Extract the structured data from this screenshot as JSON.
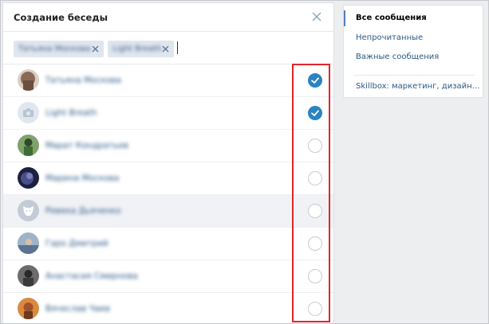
{
  "modal": {
    "title": "Создание беседы",
    "close_icon": "close-icon",
    "chips": [
      {
        "name": "Татьяна Москова"
      },
      {
        "name": "Light Breath"
      }
    ],
    "rows": [
      {
        "name": "Татьяна Москова",
        "checked": true,
        "avatar_color": "#8a6a55"
      },
      {
        "name": "Light Breath",
        "checked": true,
        "avatar_color": "#e1e7ee"
      },
      {
        "name": "Марат Кондратьев",
        "checked": false,
        "avatar_color": "#3f6a3a"
      },
      {
        "name": "Марина Москова",
        "checked": false,
        "avatar_color": "#2d3460"
      },
      {
        "name": "Ревека Дьяченко",
        "checked": false,
        "avatar_color": "#c3ccd6"
      },
      {
        "name": "Гаро Дмитрий",
        "checked": false,
        "avatar_color": "#5b7290"
      },
      {
        "name": "Анастасия Смирнова",
        "checked": false,
        "avatar_color": "#3a3a3a"
      },
      {
        "name": "Вячеслав Чаев",
        "checked": false,
        "avatar_color": "#a0522d"
      }
    ]
  },
  "menu": {
    "items": [
      {
        "label": "Все сообщения",
        "active": true
      },
      {
        "label": "Непрочитанные",
        "active": false
      },
      {
        "label": "Важные сообщения",
        "active": false
      },
      {
        "label": "Skillbox: маркетинг, дизайн...",
        "active": false
      }
    ]
  },
  "colors": {
    "accent": "#2a83c2",
    "link": "#2a5885",
    "highlight": "#e0262b"
  }
}
